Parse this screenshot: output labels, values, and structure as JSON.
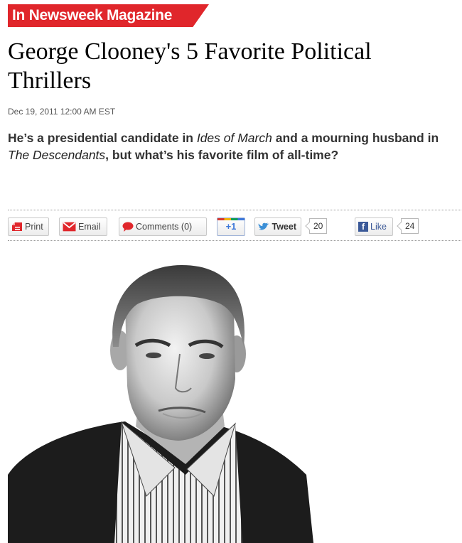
{
  "section_tag": "In Newsweek Magazine",
  "article": {
    "title": "George Clooney's 5 Favorite Political Thrillers",
    "dateline": "Dec 19, 2011 12:00 AM EST",
    "dek": {
      "part1": "He’s a presidential candidate in ",
      "italic1": "Ides of March",
      "part2": " and a mourning husband in ",
      "italic2": "The Descendants",
      "part3": ", but what’s his favorite film of all-time?"
    }
  },
  "toolbar": {
    "print_label": "Print",
    "email_label": "Email",
    "comments_label": "Comments (0)",
    "plusone_label": "+1",
    "tweet_label": "Tweet",
    "tweet_count": "20",
    "like_label": "Like",
    "like_count": "24"
  },
  "colors": {
    "brand_red": "#e0262b",
    "twitter_blue": "#3b8fd6",
    "facebook_blue": "#3b5998",
    "google_blue": "#3c77d9"
  },
  "icons": [
    "print-icon",
    "email-icon",
    "comment-icon",
    "twitter-bird-icon",
    "facebook-icon"
  ]
}
